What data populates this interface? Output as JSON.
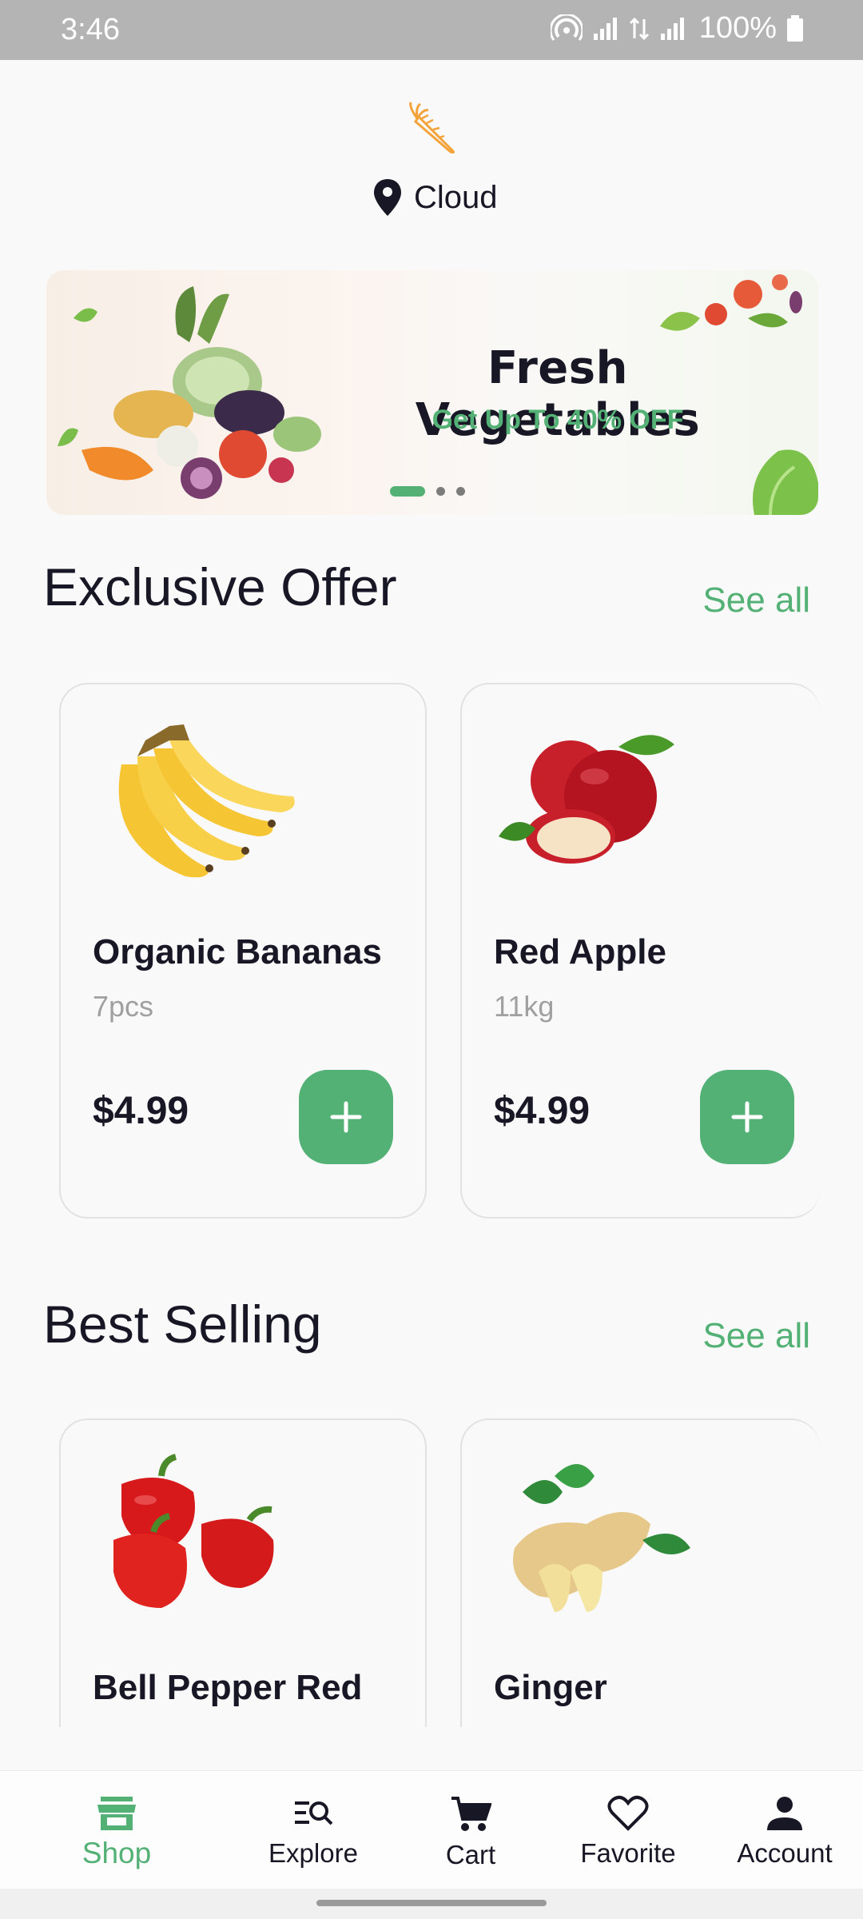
{
  "status_bar": {
    "time": "3:46",
    "battery": "100%"
  },
  "header": {
    "location": "Cloud",
    "logo_icon": "carrot-icon",
    "pin_icon": "location-pin-icon"
  },
  "banner": {
    "title": "Fresh Vegetables",
    "subtitle": "Get Up To 40% OFF",
    "page_count": 3,
    "active_page": 1
  },
  "colors": {
    "accent": "#53b175",
    "text": "#181725",
    "muted": "#a0a0a0"
  },
  "exclusive_offer": {
    "title": "Exclusive Offer",
    "see_all": "See all",
    "products": [
      {
        "name": "Organic Bananas",
        "qty": "7pcs",
        "price": "$4.99",
        "icon": "banana-icon"
      },
      {
        "name": "Red Apple",
        "qty": "11kg",
        "price": "$4.99",
        "icon": "apple-icon"
      }
    ]
  },
  "best_selling": {
    "title": "Best Selling",
    "see_all": "See all",
    "products": [
      {
        "name": "Bell Pepper Red",
        "icon": "bell-pepper-icon"
      },
      {
        "name": "Ginger",
        "icon": "ginger-icon"
      }
    ]
  },
  "bottom_nav": [
    {
      "label": "Shop",
      "icon": "store-icon",
      "active": true
    },
    {
      "label": "Explore",
      "icon": "explore-icon",
      "active": false
    },
    {
      "label": "Cart",
      "icon": "cart-icon",
      "active": false
    },
    {
      "label": "Favorite",
      "icon": "heart-icon",
      "active": false
    },
    {
      "label": "Account",
      "icon": "person-icon",
      "active": false
    }
  ]
}
